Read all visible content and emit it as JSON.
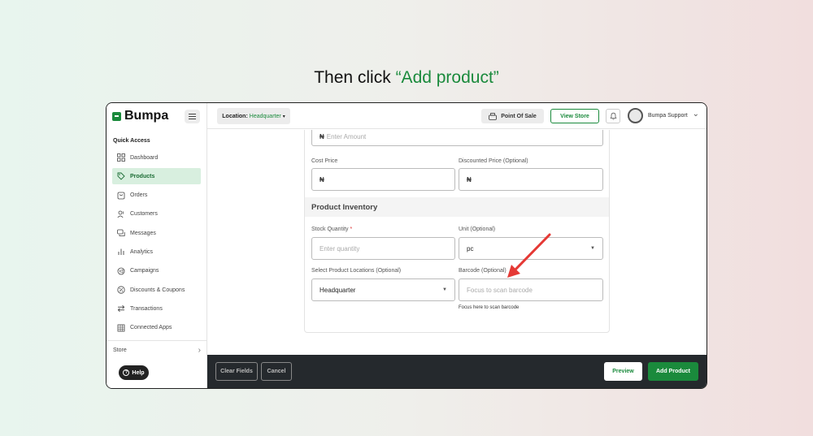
{
  "headline": {
    "prefix": "Then click ",
    "accent": "“Add product”"
  },
  "colors": {
    "brand": "#1a8a3c",
    "footer": "#25292d",
    "arrow": "#e53935"
  },
  "sidebar": {
    "logo": "Bumpa",
    "section_label": "Quick Access",
    "items": [
      {
        "label": "Dashboard",
        "icon": "grid-icon"
      },
      {
        "label": "Products",
        "icon": "tag-icon",
        "active": true
      },
      {
        "label": "Orders",
        "icon": "orders-icon"
      },
      {
        "label": "Customers",
        "icon": "users-icon"
      },
      {
        "label": "Messages",
        "icon": "chat-icon"
      },
      {
        "label": "Analytics",
        "icon": "bar-chart-icon"
      },
      {
        "label": "Campaigns",
        "icon": "megaphone-icon"
      },
      {
        "label": "Discounts & Coupons",
        "icon": "discount-icon"
      },
      {
        "label": "Transactions",
        "icon": "transfer-icon"
      },
      {
        "label": "Connected Apps",
        "icon": "apps-icon"
      }
    ],
    "store_label": "Store",
    "store_chevron": "›",
    "help_label": "Help"
  },
  "topbar": {
    "location_label": "Location:",
    "location_value": "Headquarter",
    "location_caret": "▾",
    "pos_label": "Point Of Sale",
    "view_store_label": "View Store",
    "user_name": "Bumpa Support",
    "user_chevron": "⌄"
  },
  "form": {
    "amount_placeholder": "Enter Amount",
    "currency": "₦",
    "cost_price_label": "Cost Price",
    "discounted_price_label": "Discounted Price (Optional)",
    "inventory_heading": "Product Inventory",
    "stock_label": "Stock Quantity",
    "required_mark": "*",
    "stock_placeholder": "Enter quantity",
    "unit_label": "Unit (Optional)",
    "unit_value": "pc",
    "locations_label": "Select Product Locations (Optional)",
    "locations_value": "Headquarter",
    "barcode_label": "Barcode (Optional)",
    "barcode_placeholder": "Focus to scan barcode",
    "barcode_hint": "Focus here to scan barcode"
  },
  "footer": {
    "clear_label": "Clear Fields",
    "cancel_label": "Cancel",
    "preview_label": "Preview",
    "add_label": "Add Product"
  }
}
